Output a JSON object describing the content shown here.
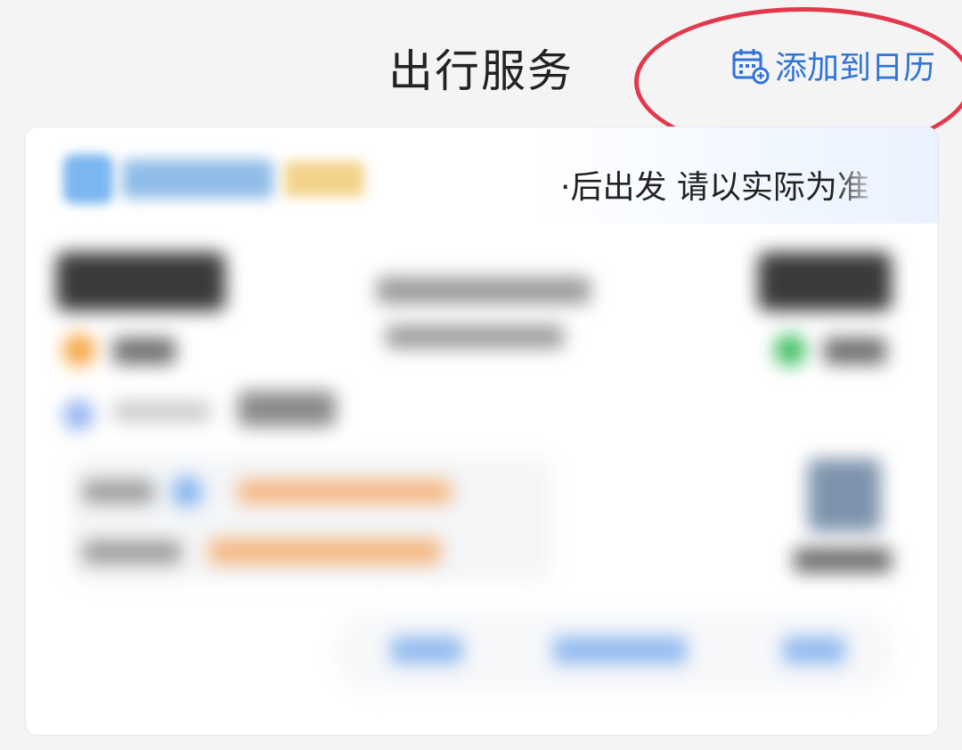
{
  "header": {
    "title": "出行服务",
    "add_calendar_label": "添加到日历"
  },
  "card": {
    "depart_note": "·后出发 请以实际为准"
  },
  "icons": {
    "calendar": "calendar-add-icon"
  },
  "colors": {
    "accent": "#2f74d6",
    "highlight": "#e3384c",
    "background": "#f4f4f5"
  }
}
